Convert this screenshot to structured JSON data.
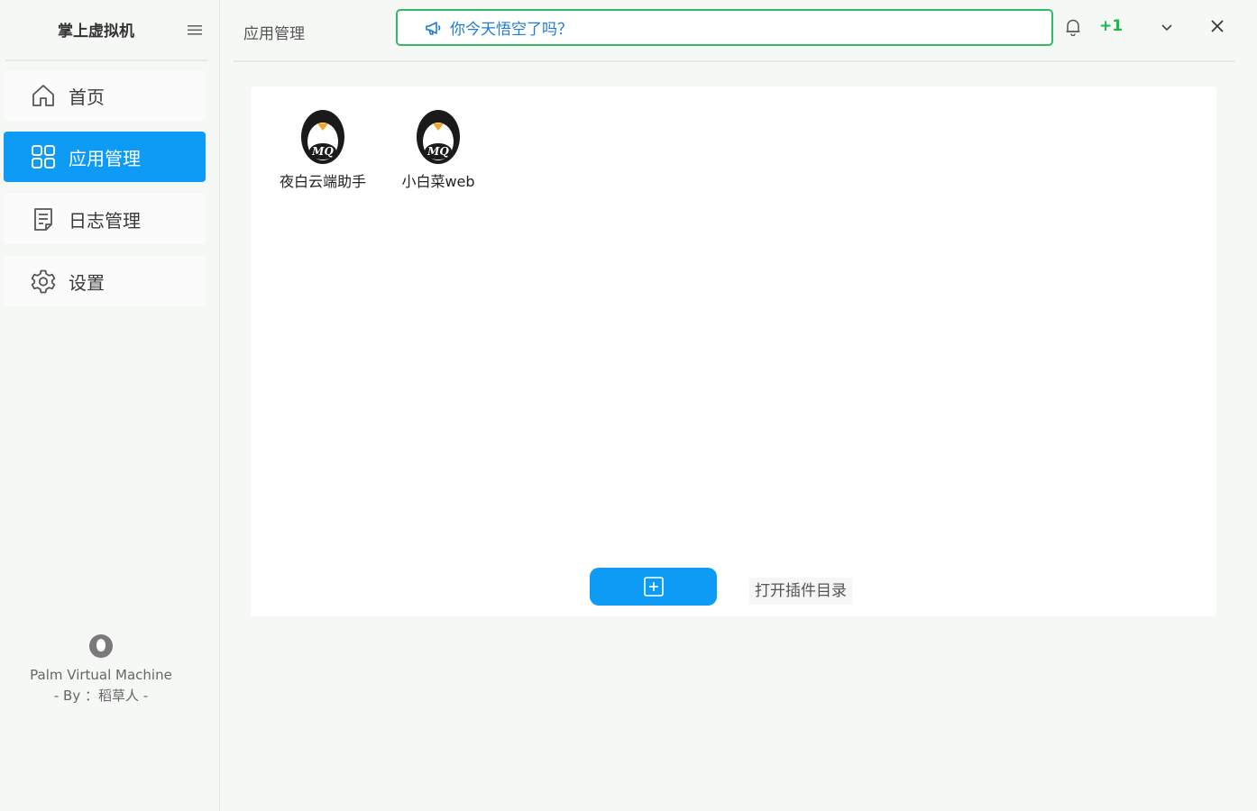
{
  "sidebar": {
    "app_title": "掌上虚拟机",
    "items": [
      {
        "label": "首页",
        "icon": "home-icon"
      },
      {
        "label": "应用管理",
        "icon": "apps-grid-icon",
        "active": true
      },
      {
        "label": "日志管理",
        "icon": "log-document-icon"
      },
      {
        "label": "设置",
        "icon": "gear-icon"
      }
    ],
    "footer": {
      "line1": "Palm Virtual Machine",
      "line2": "- By ：稻草人 -"
    }
  },
  "topbar": {
    "breadcrumb": "应用管理",
    "notice": "你今天悟空了吗？",
    "badge": "+1"
  },
  "main": {
    "apps": [
      {
        "label": "夜白云端助手",
        "logo_text": "MQ"
      },
      {
        "label": "小白菜web",
        "logo_text": "MQ"
      }
    ],
    "open_dir_label": "打开插件目录"
  },
  "colors": {
    "accent": "#0d9bf5",
    "notice_border": "#32b96a",
    "notice_text": "#1f7bd3",
    "badge": "#18b84f"
  }
}
